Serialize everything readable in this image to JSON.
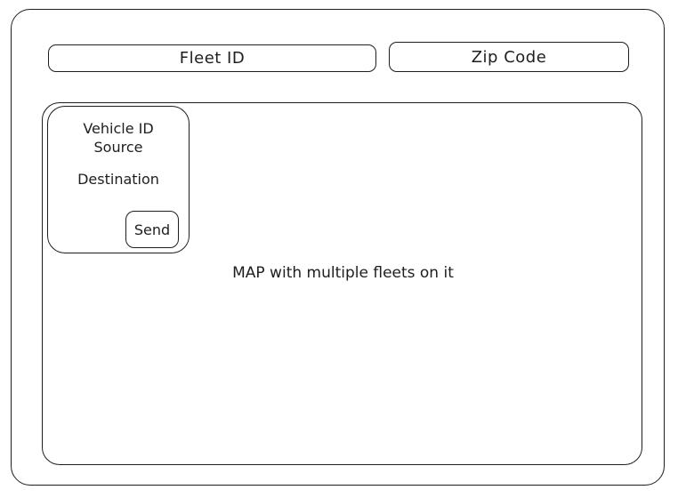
{
  "inputs": {
    "fleet_id_label": "Fleet ID",
    "zip_code_label": "Zip Code"
  },
  "map": {
    "caption": "MAP with multiple fleets on it"
  },
  "vehicle_panel": {
    "vehicle_id_label": "Vehicle ID",
    "source_label": "Source",
    "destination_label": "Destination",
    "send_label": "Send"
  }
}
